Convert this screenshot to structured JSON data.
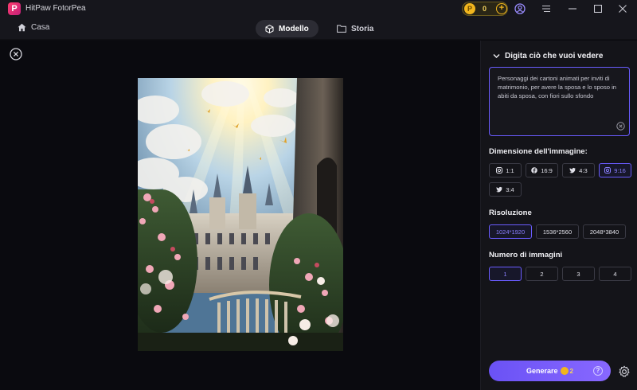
{
  "app": {
    "title": "HitPaw FotorPea",
    "logo_letter": "P",
    "coins": "0"
  },
  "nav": {
    "home_label": "Casa",
    "tabs": [
      {
        "label": "Modello",
        "active": true
      },
      {
        "label": "Storia",
        "active": false
      }
    ]
  },
  "panel": {
    "prompt_title": "Digita ciò che vuoi vedere",
    "prompt_text": "Personaggi dei cartoni animati per inviti di matrimonio, per avere la sposa e lo sposo in abiti da sposa, con fiori sullo sfondo",
    "size_title": "Dimensione dell'immagine:",
    "sizes": [
      {
        "icon": "instagram-icon",
        "label": "1:1"
      },
      {
        "icon": "facebook-icon",
        "label": "16:9"
      },
      {
        "icon": "twitter-icon",
        "label": "4:3"
      },
      {
        "icon": "instagram-icon",
        "label": "9:16",
        "selected": true
      },
      {
        "icon": "twitter-icon",
        "label": "3:4"
      }
    ],
    "resolution_title": "Risoluzione",
    "resolutions": [
      {
        "label": "1024*1920",
        "selected": true
      },
      {
        "label": "1536*2560"
      },
      {
        "label": "2048*3840"
      }
    ],
    "count_title": "Numero di immagini",
    "counts": [
      {
        "label": "1",
        "selected": true
      },
      {
        "label": "2"
      },
      {
        "label": "3"
      },
      {
        "label": "4"
      }
    ],
    "generate_label": "Generare",
    "generate_cost": "2",
    "help_glyph": "?"
  },
  "colors": {
    "accent": "#6a5cff",
    "coin": "#f2b61e",
    "background": "#0a0a0f",
    "panel": "#141419"
  }
}
